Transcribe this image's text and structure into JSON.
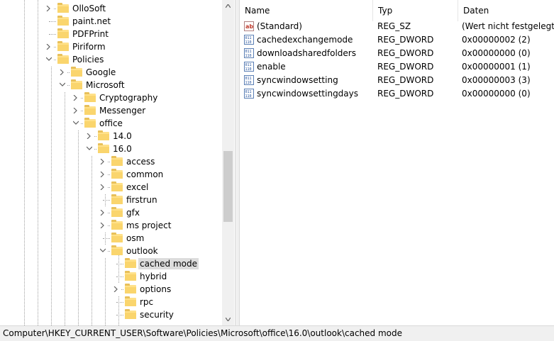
{
  "tree": {
    "nodes": [
      {
        "label": "OlloSoft",
        "expander": "collapsed"
      },
      {
        "label": "paint.net",
        "expander": "none"
      },
      {
        "label": "PDFPrint",
        "expander": "none"
      },
      {
        "label": "Piriform",
        "expander": "collapsed"
      },
      {
        "label": "Policies",
        "expander": "expanded"
      },
      {
        "label": "Google",
        "expander": "collapsed"
      },
      {
        "label": "Microsoft",
        "expander": "expanded"
      },
      {
        "label": "Cryptography",
        "expander": "collapsed"
      },
      {
        "label": "Messenger",
        "expander": "collapsed"
      },
      {
        "label": "office",
        "expander": "expanded"
      },
      {
        "label": "14.0",
        "expander": "collapsed"
      },
      {
        "label": "16.0",
        "expander": "expanded"
      },
      {
        "label": "access",
        "expander": "collapsed"
      },
      {
        "label": "common",
        "expander": "collapsed"
      },
      {
        "label": "excel",
        "expander": "collapsed"
      },
      {
        "label": "firstrun",
        "expander": "none"
      },
      {
        "label": "gfx",
        "expander": "collapsed"
      },
      {
        "label": "ms project",
        "expander": "collapsed"
      },
      {
        "label": "osm",
        "expander": "none"
      },
      {
        "label": "outlook",
        "expander": "expanded"
      },
      {
        "label": "cached mode",
        "expander": "none",
        "selected": true
      },
      {
        "label": "hybrid",
        "expander": "none"
      },
      {
        "label": "options",
        "expander": "collapsed"
      },
      {
        "label": "rpc",
        "expander": "none"
      },
      {
        "label": "security",
        "expander": "none"
      }
    ]
  },
  "list": {
    "columns": [
      "Name",
      "Typ",
      "Daten"
    ],
    "rows": [
      {
        "icon": "string-value-icon",
        "name": "(Standard)",
        "type": "REG_SZ",
        "data": "(Wert nicht festgelegt)"
      },
      {
        "icon": "dword-value-icon",
        "name": "cachedexchangemode",
        "type": "REG_DWORD",
        "data": "0x00000002 (2)"
      },
      {
        "icon": "dword-value-icon",
        "name": "downloadsharedfolders",
        "type": "REG_DWORD",
        "data": "0x00000000 (0)"
      },
      {
        "icon": "dword-value-icon",
        "name": "enable",
        "type": "REG_DWORD",
        "data": "0x00000001 (1)"
      },
      {
        "icon": "dword-value-icon",
        "name": "syncwindowsetting",
        "type": "REG_DWORD",
        "data": "0x00000003 (3)"
      },
      {
        "icon": "dword-value-icon",
        "name": "syncwindowsettingdays",
        "type": "REG_DWORD",
        "data": "0x00000000 (0)"
      }
    ]
  },
  "statusbar": {
    "path": "Computer\\HKEY_CURRENT_USER\\Software\\Policies\\Microsoft\\office\\16.0\\outlook\\cached mode"
  },
  "colors": {
    "folder": "#fad56d",
    "selection": "#dcdcdc",
    "statusbar_bg": "#f0f0f0"
  }
}
